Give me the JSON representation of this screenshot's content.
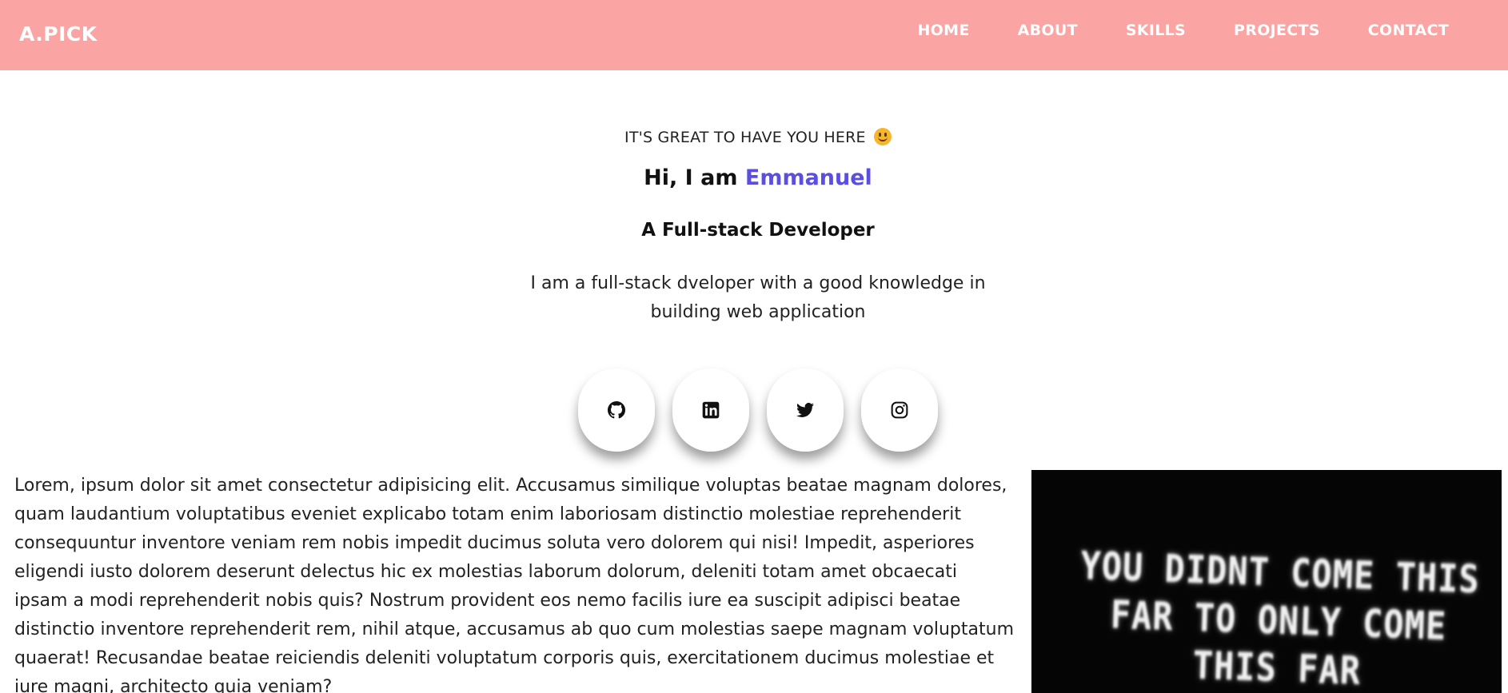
{
  "brand": "A.PICK",
  "nav": {
    "items": [
      {
        "label": "HOME"
      },
      {
        "label": "ABOUT"
      },
      {
        "label": "SKILLS"
      },
      {
        "label": "PROJECTS"
      },
      {
        "label": "CONTACT"
      }
    ]
  },
  "hero": {
    "greeting": "IT'S GREAT TO HAVE YOU HERE",
    "intro_prefix": "Hi, I am",
    "name": "Emmanuel",
    "role": "A Full-stack Developer",
    "bio": "I am a full-stack dveloper with a good knowledge in building web application"
  },
  "socials": [
    {
      "icon": "github-icon"
    },
    {
      "icon": "linkedin-icon"
    },
    {
      "icon": "twitter-icon"
    },
    {
      "icon": "instagram-icon"
    }
  ],
  "about": {
    "text": "Lorem, ipsum dolor sit amet consectetur adipisicing elit. Accusamus similique voluptas beatae magnam dolores, quam laudantium voluptatibus eveniet explicabo totam enim laboriosam distinctio molestiae reprehenderit consequuntur inventore veniam rem nobis impedit ducimus soluta vero dolorem qui nisi! Impedit, asperiores eligendi iusto dolorem deserunt delectus hic ex molestias laborum dolorum, deleniti totam amet obcaecati ipsam a modi reprehenderit nobis quis? Nostrum provident eos nemo facilis iure ea suscipit adipisci beatae distinctio inventore reprehenderit rem, nihil atque, accusamus ab quo cum molestias saepe magnam voluptatum quaerat! Recusandae beatae reiciendis deleniti voluptatum corporis quis, exercitationem ducimus molestiae et iure magni, architecto quia veniam?"
  },
  "poster": {
    "line1": "YOU DIDNT COME THIS",
    "line2": "FAR TO ONLY COME",
    "line3": "THIS FAR"
  },
  "colors": {
    "navbar": "#fba4a4",
    "accent_name": "#5a4fde"
  }
}
